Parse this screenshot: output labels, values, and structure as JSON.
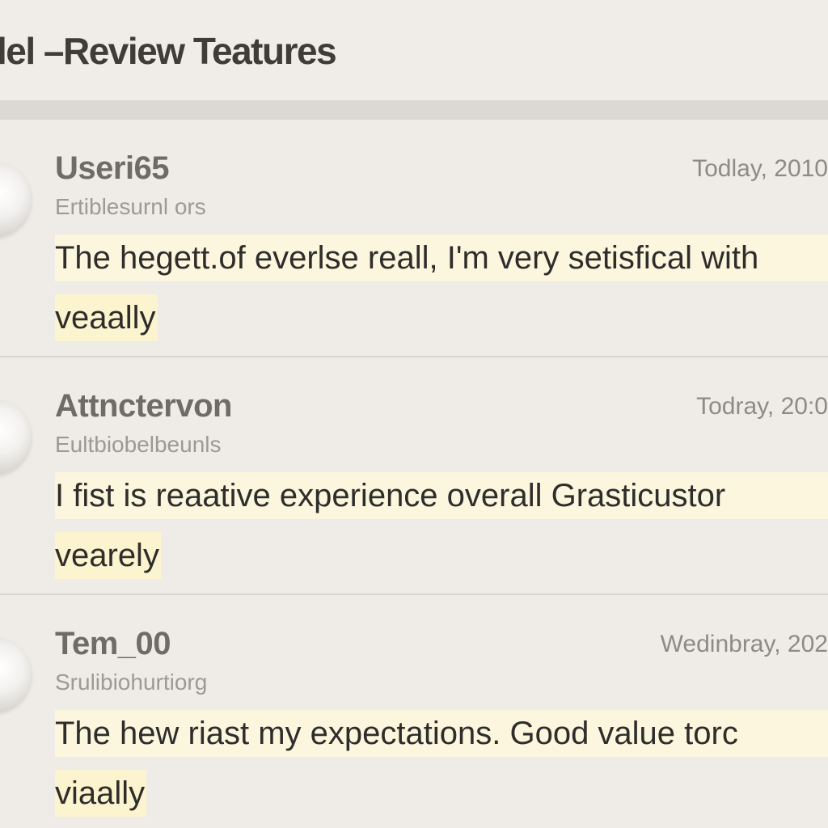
{
  "header": {
    "title": "lel –Review Teatures"
  },
  "reviews": [
    {
      "username": "Useri65",
      "subtitle": "Ertiblesurnl ors",
      "date": "Todlay, 2010",
      "text_line_1": "The hegett.of everlse reall, I'm very setisfical with",
      "text_line_2": "veaally"
    },
    {
      "username": "Attnctervon",
      "subtitle": "Eultbiobelbeunls",
      "date": "Todray, 20:0",
      "text_line_1": "I fist is reaative experience overall  Grasticustor",
      "text_line_2": "vearely"
    },
    {
      "username": "Tem_00",
      "subtitle": "Srulibiohurtiorg",
      "date": "Wedinbray, 202",
      "text_line_1": "The hew riast my expectations. Good value torc",
      "text_line_2": "viaally"
    }
  ],
  "colors": {
    "background": "#efebe7",
    "highlight": "#fbf6dd",
    "divider": "#d8d4cf",
    "title": "#3f3c39"
  },
  "icons": {
    "avatar": "user-avatar-icon"
  }
}
